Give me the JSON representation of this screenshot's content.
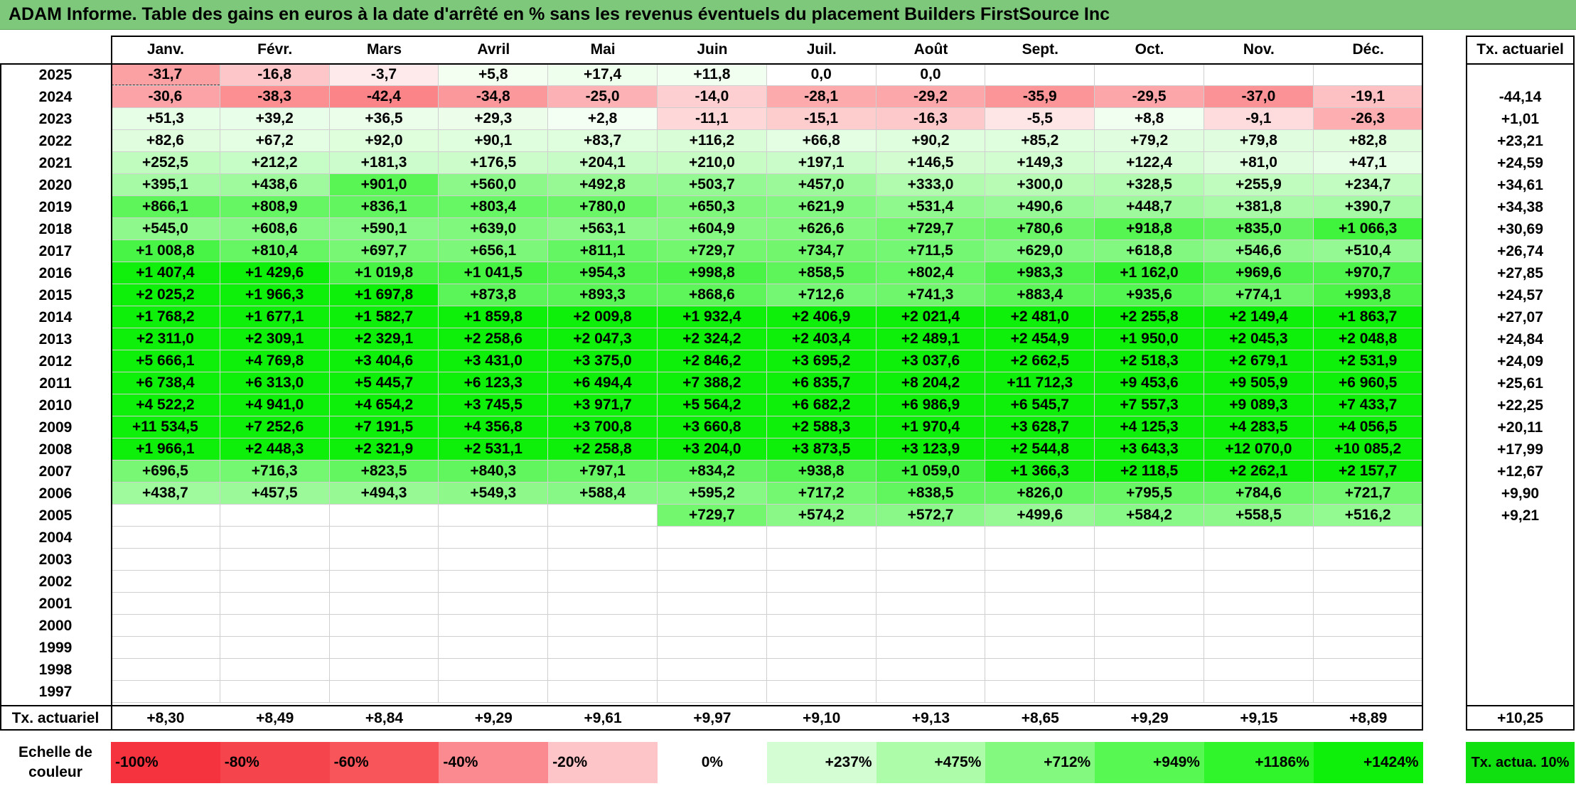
{
  "title": "ADAM Informe. Table des gains en euros à la date d'arrêté en % sans les revenus éventuels du placement Builders FirstSource Inc",
  "months": [
    "Janv.",
    "Févr.",
    "Mars",
    "Avril",
    "Mai",
    "Juin",
    "Juil.",
    "Août",
    "Sept.",
    "Oct.",
    "Nov.",
    "Déc."
  ],
  "right_header": "Tx. actuariel",
  "rows": [
    {
      "year": "2025",
      "values": [
        "-31,7",
        "-16,8",
        "-3,7",
        "+5,8",
        "+17,4",
        "+11,8",
        "0,0",
        "0,0",
        "",
        "",
        "",
        ""
      ],
      "rate": ""
    },
    {
      "year": "2024",
      "values": [
        "-30,6",
        "-38,3",
        "-42,4",
        "-34,8",
        "-25,0",
        "-14,0",
        "-28,1",
        "-29,2",
        "-35,9",
        "-29,5",
        "-37,0",
        "-19,1"
      ],
      "rate": "-44,14"
    },
    {
      "year": "2023",
      "values": [
        "+51,3",
        "+39,2",
        "+36,5",
        "+29,3",
        "+2,8",
        "-11,1",
        "-15,1",
        "-16,3",
        "-5,5",
        "+8,8",
        "-9,1",
        "-26,3"
      ],
      "rate": "+1,01"
    },
    {
      "year": "2022",
      "values": [
        "+82,6",
        "+67,2",
        "+92,0",
        "+90,1",
        "+83,7",
        "+116,2",
        "+66,8",
        "+90,2",
        "+85,2",
        "+79,2",
        "+79,8",
        "+82,8"
      ],
      "rate": "+23,21"
    },
    {
      "year": "2021",
      "values": [
        "+252,5",
        "+212,2",
        "+181,3",
        "+176,5",
        "+204,1",
        "+210,0",
        "+197,1",
        "+146,5",
        "+149,3",
        "+122,4",
        "+81,0",
        "+47,1"
      ],
      "rate": "+24,59"
    },
    {
      "year": "2020",
      "values": [
        "+395,1",
        "+438,6",
        "+901,0",
        "+560,0",
        "+492,8",
        "+503,7",
        "+457,0",
        "+333,0",
        "+300,0",
        "+328,5",
        "+255,9",
        "+234,7"
      ],
      "rate": "+34,61"
    },
    {
      "year": "2019",
      "values": [
        "+866,1",
        "+808,9",
        "+836,1",
        "+803,4",
        "+780,0",
        "+650,3",
        "+621,9",
        "+531,4",
        "+490,6",
        "+448,7",
        "+381,8",
        "+390,7"
      ],
      "rate": "+34,38"
    },
    {
      "year": "2018",
      "values": [
        "+545,0",
        "+608,6",
        "+590,1",
        "+639,0",
        "+563,1",
        "+604,9",
        "+626,6",
        "+729,7",
        "+780,6",
        "+918,8",
        "+835,0",
        "+1 066,3"
      ],
      "rate": "+30,69"
    },
    {
      "year": "2017",
      "values": [
        "+1 008,8",
        "+810,4",
        "+697,7",
        "+656,1",
        "+811,1",
        "+729,7",
        "+734,7",
        "+711,5",
        "+629,0",
        "+618,8",
        "+546,6",
        "+510,4"
      ],
      "rate": "+26,74"
    },
    {
      "year": "2016",
      "values": [
        "+1 407,4",
        "+1 429,6",
        "+1 019,8",
        "+1 041,5",
        "+954,3",
        "+998,8",
        "+858,5",
        "+802,4",
        "+983,3",
        "+1 162,0",
        "+969,6",
        "+970,7"
      ],
      "rate": "+27,85"
    },
    {
      "year": "2015",
      "values": [
        "+2 025,2",
        "+1 966,3",
        "+1 697,8",
        "+873,8",
        "+893,3",
        "+868,6",
        "+712,6",
        "+741,3",
        "+883,4",
        "+935,6",
        "+774,1",
        "+993,8"
      ],
      "rate": "+24,57"
    },
    {
      "year": "2014",
      "values": [
        "+1 768,2",
        "+1 677,1",
        "+1 582,7",
        "+1 859,8",
        "+2 009,8",
        "+1 932,4",
        "+2 406,9",
        "+2 021,4",
        "+2 481,0",
        "+2 255,8",
        "+2 149,4",
        "+1 863,7"
      ],
      "rate": "+27,07"
    },
    {
      "year": "2013",
      "values": [
        "+2 311,0",
        "+2 309,1",
        "+2 329,1",
        "+2 258,6",
        "+2 047,3",
        "+2 324,2",
        "+2 403,4",
        "+2 489,1",
        "+2 454,9",
        "+1 950,0",
        "+2 045,3",
        "+2 048,8"
      ],
      "rate": "+24,84"
    },
    {
      "year": "2012",
      "values": [
        "+5 666,1",
        "+4 769,8",
        "+3 404,6",
        "+3 431,0",
        "+3 375,0",
        "+2 846,2",
        "+3 695,2",
        "+3 037,6",
        "+2 662,5",
        "+2 518,3",
        "+2 679,1",
        "+2 531,9"
      ],
      "rate": "+24,09"
    },
    {
      "year": "2011",
      "values": [
        "+6 738,4",
        "+6 313,0",
        "+5 445,7",
        "+6 123,3",
        "+6 494,4",
        "+7 388,2",
        "+6 835,7",
        "+8 204,2",
        "+11 712,3",
        "+9 453,6",
        "+9 505,9",
        "+6 960,5"
      ],
      "rate": "+25,61"
    },
    {
      "year": "2010",
      "values": [
        "+4 522,2",
        "+4 941,0",
        "+4 654,2",
        "+3 745,5",
        "+3 971,7",
        "+5 564,2",
        "+6 682,2",
        "+6 986,9",
        "+6 545,7",
        "+7 557,3",
        "+9 089,3",
        "+7 433,7"
      ],
      "rate": "+22,25"
    },
    {
      "year": "2009",
      "values": [
        "+11 534,5",
        "+7 252,6",
        "+7 191,5",
        "+4 356,8",
        "+3 700,8",
        "+3 660,8",
        "+2 588,3",
        "+1 970,4",
        "+3 628,7",
        "+4 125,3",
        "+4 283,5",
        "+4 056,5"
      ],
      "rate": "+20,11"
    },
    {
      "year": "2008",
      "values": [
        "+1 966,1",
        "+2 448,3",
        "+2 321,9",
        "+2 531,1",
        "+2 258,8",
        "+3 204,0",
        "+3 873,5",
        "+3 123,9",
        "+2 544,8",
        "+3 643,3",
        "+12 070,0",
        "+10 085,2"
      ],
      "rate": "+17,99"
    },
    {
      "year": "2007",
      "values": [
        "+696,5",
        "+716,3",
        "+823,5",
        "+840,3",
        "+797,1",
        "+834,2",
        "+938,8",
        "+1 059,0",
        "+1 366,3",
        "+2 118,5",
        "+2 262,1",
        "+2 157,7"
      ],
      "rate": "+12,67"
    },
    {
      "year": "2006",
      "values": [
        "+438,7",
        "+457,5",
        "+494,3",
        "+549,3",
        "+588,4",
        "+595,2",
        "+717,2",
        "+838,5",
        "+826,0",
        "+795,5",
        "+784,6",
        "+721,7"
      ],
      "rate": "+9,90"
    },
    {
      "year": "2005",
      "values": [
        "",
        "",
        "",
        "",
        "",
        "+729,7",
        "+574,2",
        "+572,7",
        "+499,6",
        "+584,2",
        "+558,5",
        "+516,2"
      ],
      "rate": "+9,21"
    },
    {
      "year": "2004",
      "values": [
        "",
        "",
        "",
        "",
        "",
        "",
        "",
        "",
        "",
        "",
        "",
        ""
      ],
      "rate": ""
    },
    {
      "year": "2003",
      "values": [
        "",
        "",
        "",
        "",
        "",
        "",
        "",
        "",
        "",
        "",
        "",
        ""
      ],
      "rate": ""
    },
    {
      "year": "2002",
      "values": [
        "",
        "",
        "",
        "",
        "",
        "",
        "",
        "",
        "",
        "",
        "",
        ""
      ],
      "rate": ""
    },
    {
      "year": "2001",
      "values": [
        "",
        "",
        "",
        "",
        "",
        "",
        "",
        "",
        "",
        "",
        "",
        ""
      ],
      "rate": ""
    },
    {
      "year": "2000",
      "values": [
        "",
        "",
        "",
        "",
        "",
        "",
        "",
        "",
        "",
        "",
        "",
        ""
      ],
      "rate": ""
    },
    {
      "year": "1999",
      "values": [
        "",
        "",
        "",
        "",
        "",
        "",
        "",
        "",
        "",
        "",
        "",
        ""
      ],
      "rate": ""
    },
    {
      "year": "1998",
      "values": [
        "",
        "",
        "",
        "",
        "",
        "",
        "",
        "",
        "",
        "",
        "",
        ""
      ],
      "rate": ""
    },
    {
      "year": "1997",
      "values": [
        "",
        "",
        "",
        "",
        "",
        "",
        "",
        "",
        "",
        "",
        "",
        ""
      ],
      "rate": ""
    }
  ],
  "totals": {
    "label": "Tx. actuariel",
    "values": [
      "+8,30",
      "+8,49",
      "+8,84",
      "+9,29",
      "+9,61",
      "+9,97",
      "+9,10",
      "+9,13",
      "+8,65",
      "+9,29",
      "+9,15",
      "+8,89"
    ],
    "rate": "+10,25"
  },
  "legend": {
    "label": "Echelle de couleur",
    "items": [
      {
        "text": "-100%",
        "color": "#f5333f",
        "align": "left"
      },
      {
        "text": "-80%",
        "color": "#f6444c",
        "align": "left"
      },
      {
        "text": "-60%",
        "color": "#f8555b",
        "align": "left"
      },
      {
        "text": "-40%",
        "color": "#fa8a8f",
        "align": "left"
      },
      {
        "text": "-20%",
        "color": "#fdc5c7",
        "align": "left"
      },
      {
        "text": "0%",
        "color": "#ffffff",
        "align": "center"
      },
      {
        "text": "+237%",
        "color": "#d5fdd4",
        "align": "right"
      },
      {
        "text": "+475%",
        "color": "#acfca9",
        "align": "right"
      },
      {
        "text": "+712%",
        "color": "#83fa7f",
        "align": "right"
      },
      {
        "text": "+949%",
        "color": "#58f853",
        "align": "right"
      },
      {
        "text": "+1186%",
        "color": "#2ff52a",
        "align": "right"
      },
      {
        "text": "+1424%",
        "color": "#0ef00a",
        "align": "right"
      }
    ],
    "rate_label": "Tx. actua. 10%",
    "rate_color": "#10e010"
  }
}
